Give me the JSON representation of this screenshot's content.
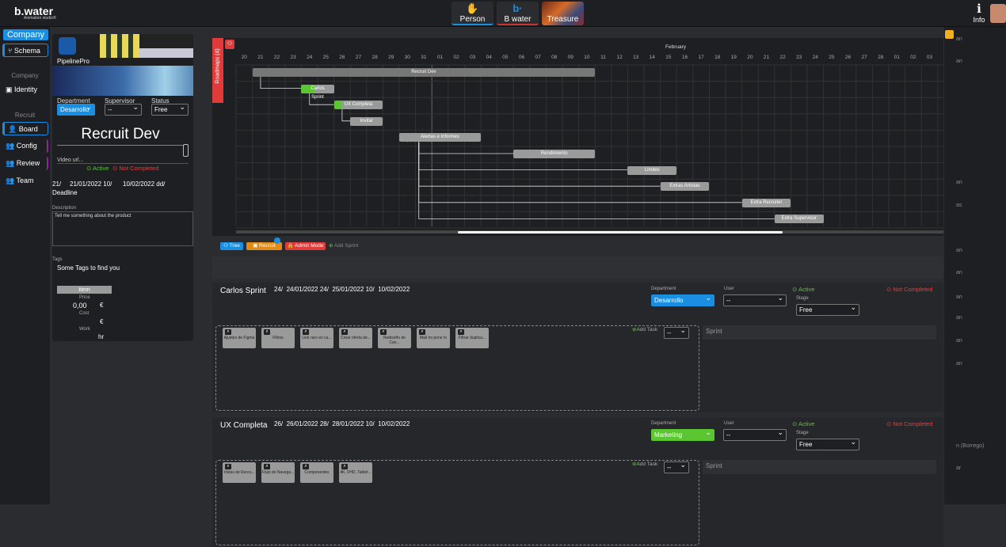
{
  "app": {
    "logo": "b.water",
    "logo_sub": "Animation studio®"
  },
  "top_tabs": [
    {
      "label": "Person"
    },
    {
      "label": "B water"
    },
    {
      "label": "Treasure"
    }
  ],
  "info_label": "Info",
  "leftnav": {
    "company": "Company",
    "schema": "Schema",
    "section_company": "Company",
    "identity": "Identity",
    "section_recruit": "Recruit",
    "board": "Board",
    "config": "Config",
    "review": "Review",
    "team": "Team"
  },
  "panel": {
    "name": "PipelinePro",
    "department_label": "Department",
    "department_value": "Desarrollo",
    "supervisor_label": "Supervisor",
    "supervisor_value": "--",
    "status_label": "Status",
    "status_value": "Free",
    "title": "Recruit Dev",
    "video_placeholder": "Video url...",
    "active": "Active",
    "not_completed": "Not Completed",
    "date1": "21/",
    "date2": "21/01/2022 10/",
    "date3": "10/02/2022 dd/",
    "deadline": "Deadline",
    "description_label": "Description",
    "description": "Tell me something about the product",
    "tags_label": "Tags",
    "tags": "Some Tags to find you",
    "item_label": "Item",
    "price_label": "Price",
    "price_value": "0,00",
    "currency": "€",
    "cost_label": "Cost",
    "cost_currency": "€",
    "work_label": "Work",
    "work_unit": "hr"
  },
  "gantt": {
    "vertical_label": "Roadmaps (4)",
    "month": "February",
    "days": [
      "20",
      "21",
      "22",
      "23",
      "24",
      "25",
      "26",
      "27",
      "28",
      "29",
      "30",
      "31",
      "01",
      "02",
      "03",
      "04",
      "05",
      "06",
      "07",
      "08",
      "09",
      "10",
      "11",
      "12",
      "13",
      "14",
      "15",
      "16",
      "17",
      "18",
      "19",
      "20",
      "21",
      "22",
      "23",
      "24",
      "25",
      "26",
      "27",
      "28",
      "01",
      "02",
      "03"
    ],
    "bars": [
      {
        "label": "Recruit Dev",
        "start": 1,
        "end": 22,
        "row": 0,
        "color": "#777"
      },
      {
        "label": "Carlos Sprint",
        "start": 4,
        "end": 6,
        "row": 1,
        "color": "#9a9a9a",
        "done": 0.4
      },
      {
        "label": "UX Completa",
        "start": 6,
        "end": 9,
        "row": 2,
        "color": "#9a9a9a",
        "done": 0.15
      },
      {
        "label": "Invitar",
        "start": 7,
        "end": 9,
        "row": 3,
        "color": "#9a9a9a"
      },
      {
        "label": "Alertas e Informes",
        "start": 10,
        "end": 15,
        "row": 4,
        "color": "#9a9a9a"
      },
      {
        "label": "Rendimiento",
        "start": 17,
        "end": 22,
        "row": 5,
        "color": "#9a9a9a"
      },
      {
        "label": "Limites",
        "start": 24,
        "end": 27,
        "row": 6,
        "color": "#9a9a9a"
      },
      {
        "label": "Extras Artistas",
        "start": 26,
        "end": 29,
        "row": 7,
        "color": "#9a9a9a"
      },
      {
        "label": "Extra Recruiter",
        "start": 31,
        "end": 34,
        "row": 8,
        "color": "#9a9a9a"
      },
      {
        "label": "Extra Supervisor",
        "start": 33,
        "end": 36,
        "row": 9,
        "color": "#9a9a9a"
      }
    ]
  },
  "toolbar": {
    "tree": "Tree",
    "recruit": "Recruit",
    "admin": "Admin Mode",
    "add_sprint": "Add Sprint"
  },
  "sprints": [
    {
      "title": "Carlos Sprint",
      "d1": "24/",
      "d2": "24/01/2022 24/",
      "d3": "25/01/2022 10/",
      "d4": "10/02/2022",
      "department": "Desarrollo",
      "dept_color": "#1a8ee0",
      "user": "--",
      "stage": "Free",
      "active": "Active",
      "not_completed": "Not Completed",
      "department_label": "Department",
      "user_label": "User",
      "stage_label": "Stage",
      "add_task": "Add Task",
      "sprint_label": "Sprint",
      "filter": "--",
      "tasks": [
        "Ajustes de Figma",
        "Filtros",
        "Link raro en ca...",
        "Crear oferta de...",
        "Rediseño de Can...",
        "Mail no pone \\n",
        "Filtrar duplica..."
      ]
    },
    {
      "title": "UX Completa",
      "d1": "26/",
      "d2": "26/01/2022 28/",
      "d3": "28/01/2022 10/",
      "d4": "10/02/2022",
      "department": "Marketing",
      "dept_color": "#5cc532",
      "user": "--",
      "stage": "Free",
      "active": "Active",
      "not_completed": "Not Completed",
      "department_label": "Department",
      "user_label": "User",
      "stage_label": "Stage",
      "add_task": "Add Task",
      "sprint_label": "Sprint",
      "filter": "--",
      "tasks": [
        "Vistas de Recru...",
        "Flujo de Navega...",
        "Componentes",
        "4K, FHD, Tablet..."
      ]
    }
  ],
  "right_texts": [
    "an",
    "an",
    "an",
    "as",
    "an",
    "an",
    "an",
    "an",
    "an",
    "an",
    "n (Borrego)",
    "ar"
  ]
}
